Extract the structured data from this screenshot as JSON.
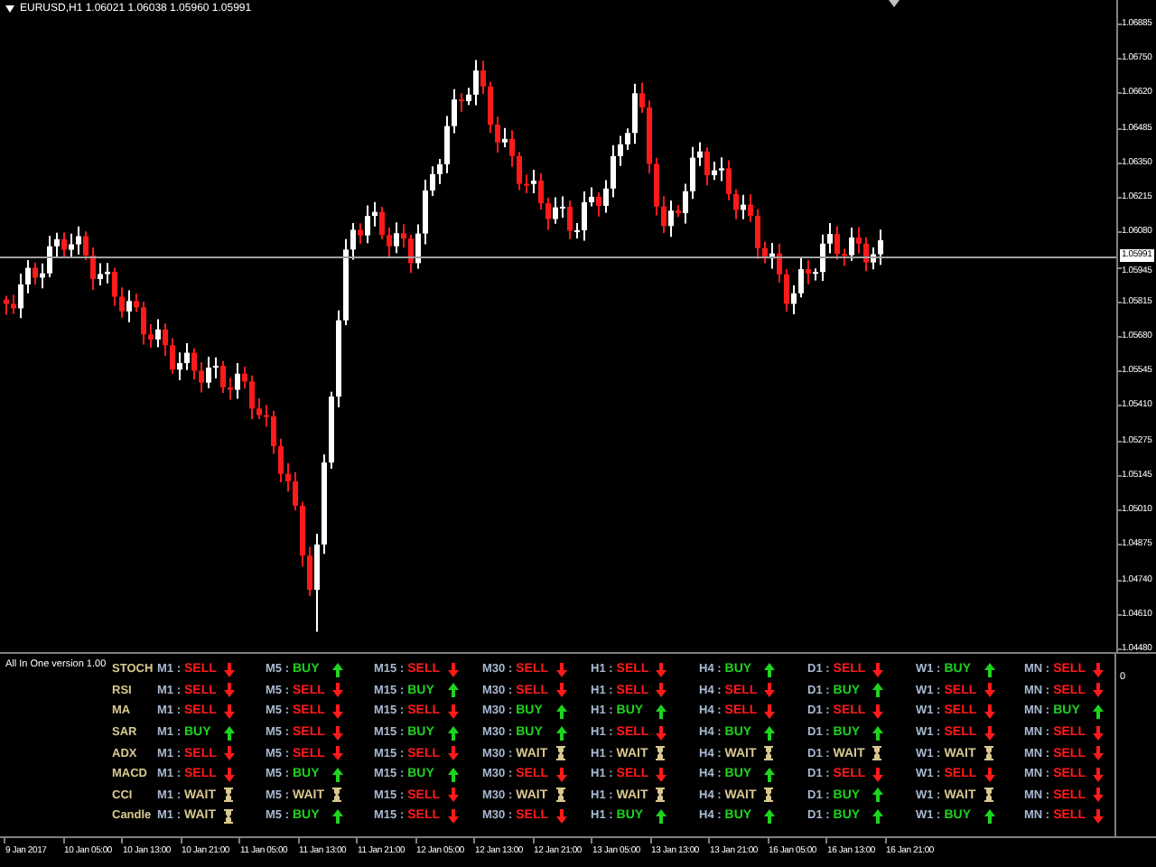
{
  "chart": {
    "title": "EURUSD,H1 1.06021 1.06038 1.05960 1.05991",
    "current_price": "1.05991",
    "price_axis": [
      "1.06885",
      "1.06750",
      "1.06620",
      "1.06485",
      "1.06350",
      "1.06215",
      "1.06080",
      "1.05945",
      "1.05815",
      "1.05680",
      "1.05545",
      "1.05410",
      "1.05275",
      "1.05145",
      "1.05010",
      "1.04875",
      "1.04740",
      "1.04610",
      "1.04480"
    ]
  },
  "indicator_panel": {
    "title": "All In One version 1.00",
    "axis_label": "0",
    "rows": [
      {
        "name": "STOCH",
        "signals": [
          {
            "tf": "M1 :",
            "text": "SELL",
            "kind": "sell"
          },
          {
            "tf": "M5 :",
            "text": "BUY",
            "kind": "buy"
          },
          {
            "tf": "M15 :",
            "text": "SELL",
            "kind": "sell"
          },
          {
            "tf": "M30 :",
            "text": "SELL",
            "kind": "sell"
          },
          {
            "tf": "H1 :",
            "text": "SELL",
            "kind": "sell"
          },
          {
            "tf": "H4 :",
            "text": "BUY",
            "kind": "buy"
          },
          {
            "tf": "D1 :",
            "text": "SELL",
            "kind": "sell"
          },
          {
            "tf": "W1 :",
            "text": "BUY",
            "kind": "buy"
          },
          {
            "tf": "MN :",
            "text": "SELL",
            "kind": "sell"
          }
        ]
      },
      {
        "name": "RSI",
        "signals": [
          {
            "tf": "M1 :",
            "text": "SELL",
            "kind": "sell"
          },
          {
            "tf": "M5 :",
            "text": "SELL",
            "kind": "sell"
          },
          {
            "tf": "M15 :",
            "text": "BUY",
            "kind": "buy"
          },
          {
            "tf": "M30 :",
            "text": "SELL",
            "kind": "sell"
          },
          {
            "tf": "H1 :",
            "text": "SELL",
            "kind": "sell"
          },
          {
            "tf": "H4 :",
            "text": "SELL",
            "kind": "sell"
          },
          {
            "tf": "D1 :",
            "text": "BUY",
            "kind": "buy"
          },
          {
            "tf": "W1 :",
            "text": "SELL",
            "kind": "sell"
          },
          {
            "tf": "MN :",
            "text": "SELL",
            "kind": "sell"
          }
        ]
      },
      {
        "name": "MA",
        "signals": [
          {
            "tf": "M1 :",
            "text": "SELL",
            "kind": "sell"
          },
          {
            "tf": "M5 :",
            "text": "SELL",
            "kind": "sell"
          },
          {
            "tf": "M15 :",
            "text": "SELL",
            "kind": "sell"
          },
          {
            "tf": "M30 :",
            "text": "BUY",
            "kind": "buy"
          },
          {
            "tf": "H1 :",
            "text": "BUY",
            "kind": "buy"
          },
          {
            "tf": "H4 :",
            "text": "SELL",
            "kind": "sell"
          },
          {
            "tf": "D1 :",
            "text": "SELL",
            "kind": "sell"
          },
          {
            "tf": "W1 :",
            "text": "SELL",
            "kind": "sell"
          },
          {
            "tf": "MN :",
            "text": "BUY",
            "kind": "buy"
          }
        ]
      },
      {
        "name": "SAR",
        "signals": [
          {
            "tf": "M1 :",
            "text": "BUY",
            "kind": "buy"
          },
          {
            "tf": "M5 :",
            "text": "SELL",
            "kind": "sell"
          },
          {
            "tf": "M15 :",
            "text": "BUY",
            "kind": "buy"
          },
          {
            "tf": "M30 :",
            "text": "BUY",
            "kind": "buy"
          },
          {
            "tf": "H1 :",
            "text": "SELL",
            "kind": "sell"
          },
          {
            "tf": "H4 :",
            "text": "BUY",
            "kind": "buy"
          },
          {
            "tf": "D1 :",
            "text": "BUY",
            "kind": "buy"
          },
          {
            "tf": "W1 :",
            "text": "SELL",
            "kind": "sell"
          },
          {
            "tf": "MN :",
            "text": "SELL",
            "kind": "sell"
          }
        ]
      },
      {
        "name": "ADX",
        "signals": [
          {
            "tf": "M1 :",
            "text": "SELL",
            "kind": "sell"
          },
          {
            "tf": "M5 :",
            "text": "SELL",
            "kind": "sell"
          },
          {
            "tf": "M15 :",
            "text": "SELL",
            "kind": "sell"
          },
          {
            "tf": "M30 :",
            "text": "WAIT",
            "kind": "wait"
          },
          {
            "tf": "H1 :",
            "text": "WAIT",
            "kind": "wait"
          },
          {
            "tf": "H4 :",
            "text": "WAIT",
            "kind": "wait"
          },
          {
            "tf": "D1 :",
            "text": "WAIT",
            "kind": "wait"
          },
          {
            "tf": "W1 :",
            "text": "WAIT",
            "kind": "wait"
          },
          {
            "tf": "MN :",
            "text": "SELL",
            "kind": "sell"
          }
        ]
      },
      {
        "name": "MACD",
        "signals": [
          {
            "tf": "M1 :",
            "text": "SELL",
            "kind": "sell"
          },
          {
            "tf": "M5 :",
            "text": "BUY",
            "kind": "buy"
          },
          {
            "tf": "M15 :",
            "text": "BUY",
            "kind": "buy"
          },
          {
            "tf": "M30 :",
            "text": "SELL",
            "kind": "sell"
          },
          {
            "tf": "H1 :",
            "text": "SELL",
            "kind": "sell"
          },
          {
            "tf": "H4 :",
            "text": "BUY",
            "kind": "buy"
          },
          {
            "tf": "D1 :",
            "text": "SELL",
            "kind": "sell"
          },
          {
            "tf": "W1 :",
            "text": "SELL",
            "kind": "sell"
          },
          {
            "tf": "MN :",
            "text": "SELL",
            "kind": "sell"
          }
        ]
      },
      {
        "name": "CCI",
        "signals": [
          {
            "tf": "M1 :",
            "text": "WAIT",
            "kind": "wait"
          },
          {
            "tf": "M5 :",
            "text": "WAIT",
            "kind": "wait"
          },
          {
            "tf": "M15 :",
            "text": "SELL",
            "kind": "sell"
          },
          {
            "tf": "M30 :",
            "text": "WAIT",
            "kind": "wait"
          },
          {
            "tf": "H1 :",
            "text": "WAIT",
            "kind": "wait"
          },
          {
            "tf": "H4 :",
            "text": "WAIT",
            "kind": "wait"
          },
          {
            "tf": "D1 :",
            "text": "BUY",
            "kind": "buy"
          },
          {
            "tf": "W1 :",
            "text": "WAIT",
            "kind": "wait"
          },
          {
            "tf": "MN :",
            "text": "SELL",
            "kind": "sell"
          }
        ]
      },
      {
        "name": "Candle",
        "signals": [
          {
            "tf": "M1 :",
            "text": "WAIT",
            "kind": "wait"
          },
          {
            "tf": "M5 :",
            "text": "BUY",
            "kind": "buy"
          },
          {
            "tf": "M15 :",
            "text": "SELL",
            "kind": "sell"
          },
          {
            "tf": "M30 :",
            "text": "SELL",
            "kind": "sell"
          },
          {
            "tf": "H1 :",
            "text": "BUY",
            "kind": "buy"
          },
          {
            "tf": "H4 :",
            "text": "BUY",
            "kind": "buy"
          },
          {
            "tf": "D1 :",
            "text": "BUY",
            "kind": "buy"
          },
          {
            "tf": "W1 :",
            "text": "BUY",
            "kind": "buy"
          },
          {
            "tf": "MN :",
            "text": "SELL",
            "kind": "sell"
          }
        ]
      }
    ]
  },
  "time_axis": [
    "9 Jan 2017",
    "10 Jan 05:00",
    "10 Jan 13:00",
    "10 Jan 21:00",
    "11 Jan 05:00",
    "11 Jan 13:00",
    "11 Jan 21:00",
    "12 Jan 05:00",
    "12 Jan 13:00",
    "12 Jan 21:00",
    "13 Jan 05:00",
    "13 Jan 13:00",
    "13 Jan 21:00",
    "16 Jan 05:00",
    "16 Jan 13:00",
    "16 Jan 21:00"
  ]
}
